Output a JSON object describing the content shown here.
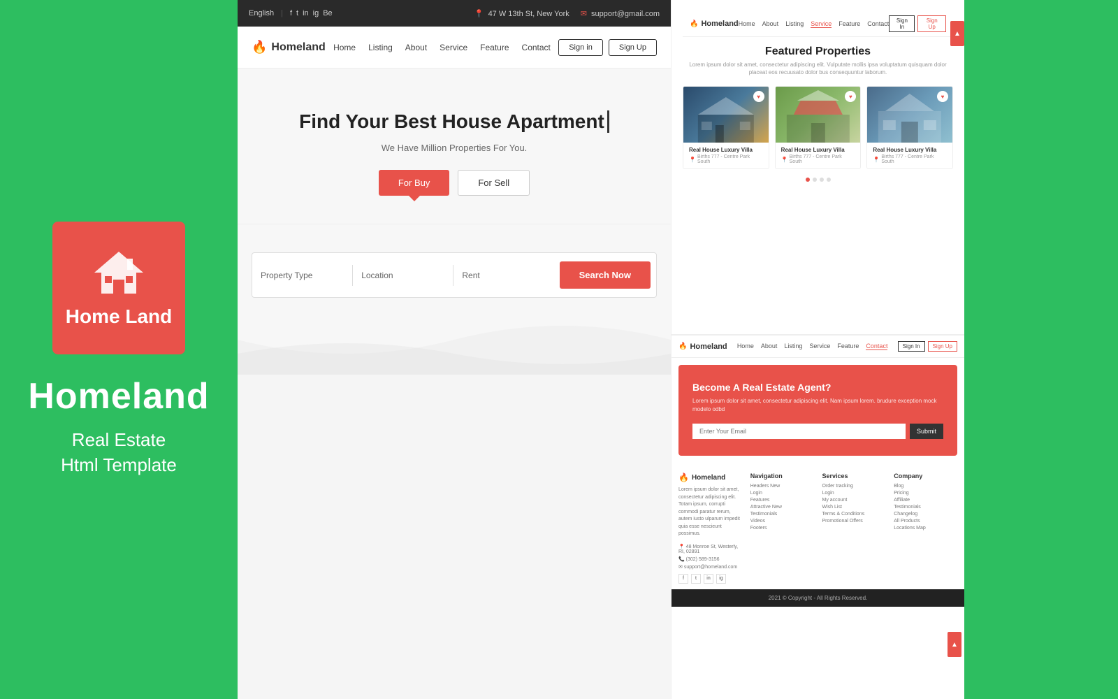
{
  "left": {
    "logo_text": "Home Land",
    "brand_title": "Homeland",
    "brand_subtitle_line1": "Real Estate",
    "brand_subtitle_line2": "Html Template"
  },
  "center": {
    "topbar": {
      "language": "English",
      "social_icons": [
        "f",
        "t",
        "in",
        "ig",
        "be"
      ],
      "address": "47 W 13th St, New York",
      "email": "support@gmail.com"
    },
    "navbar": {
      "logo": "Homeland",
      "links": [
        "Home",
        "Listing",
        "About",
        "Service",
        "Feature",
        "Contact"
      ],
      "signin": "Sign in",
      "signup": "Sign Up"
    },
    "hero": {
      "title": "Find Your Best House Apartment",
      "subtitle": "We Have Million Properties For You.",
      "tab_buy": "For Buy",
      "tab_sell": "For Sell"
    },
    "search": {
      "property_type": "Property Type",
      "location": "Location",
      "rent": "Rent",
      "button": "Search Now"
    }
  },
  "right_top": {
    "navbar": {
      "logo": "Homeland",
      "links": [
        "Home",
        "About",
        "Listing",
        "Service",
        "Feature",
        "Contact"
      ],
      "signin": "Sign In",
      "signup": "Sign Up",
      "active_link": "Service"
    },
    "featured": {
      "title": "Featured Properties",
      "description": "Lorem ipsum dolor sit amet, consectetur adipiscing elit. Vulputate mollis ipsa voluptatum quisquam dolor placeat eos recuusato dolor bus consequuntur laborum.",
      "cards": [
        {
          "name": "Real House Luxury Villa",
          "address": "Births 777 - Centre Park South"
        },
        {
          "name": "Real House Luxury Villa",
          "address": "Births 777 - Centre Park South"
        },
        {
          "name": "Real House Luxury Villa",
          "address": "Births 777 - Centre Park South"
        }
      ]
    },
    "pagination": [
      true,
      false,
      false,
      false
    ]
  },
  "right_bottom": {
    "navbar": {
      "logo": "Homeland",
      "links": [
        "Home",
        "About",
        "Listing",
        "Service",
        "Feature",
        "Contact"
      ],
      "signin": "Sign In",
      "signup": "Sign Up",
      "active_link": "Contact"
    },
    "agent": {
      "title": "Become A Real Estate Agent?",
      "description": "Lorem ipsum dolor sit amet, consectetur adipiscing elit. Nam ipsum lorem. brudure exception mock modelo odbd",
      "input_placeholder": "Enter Your Email",
      "submit": "Submit"
    },
    "footer": {
      "logo": "Homeland",
      "description": "Lorem ipsum dolor sit amet, consectetur adipiscing elit. Totam ipsum, corrupti commodi paratur rerum, autem iusto ulparum impedit quia esse nescieunt possimus.",
      "address": "48 Monroe St, Westerly, RI, 02891",
      "phone": "(302) 589-3156",
      "email": "support@homeland.com",
      "social": [
        "f",
        "t",
        "in",
        "ig"
      ],
      "navigation": {
        "title": "Navigation",
        "links": [
          "Headers New",
          "Login",
          "Features",
          "Attractive New",
          "Testimonials",
          "Videos",
          "Footers"
        ]
      },
      "services": {
        "title": "Services",
        "links": [
          "Order tracking",
          "Login",
          "My account",
          "Wish List",
          "Terms & Conditions",
          "Promotional Offers"
        ]
      },
      "company": {
        "title": "Company",
        "links": [
          "Blog",
          "Pricing",
          "Affiliate",
          "Testimonials",
          "Changelog",
          "All Products",
          "Locations Map"
        ]
      }
    },
    "copyright": "2021 © Copyright - All Rights Reserved."
  }
}
